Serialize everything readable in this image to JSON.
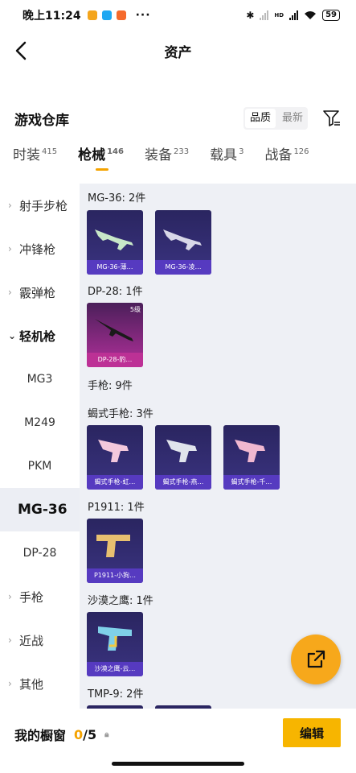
{
  "status_bar": {
    "time": "晚上11:24",
    "hd": "HD",
    "battery": "59",
    "more": "···"
  },
  "header": {
    "title": "资产"
  },
  "section": {
    "title": "游戏仓库",
    "sort_quality": "品质",
    "sort_latest": "最新"
  },
  "tabs": [
    {
      "label": "时装",
      "count": "415"
    },
    {
      "label": "枪械",
      "count": "146"
    },
    {
      "label": "装备",
      "count": "233"
    },
    {
      "label": "载具",
      "count": "3"
    },
    {
      "label": "战备",
      "count": "126"
    }
  ],
  "sidebar": {
    "categories": [
      {
        "label": "射手步枪"
      },
      {
        "label": "冲锋枪"
      },
      {
        "label": "霰弹枪"
      },
      {
        "label": "轻机枪"
      }
    ],
    "sub": [
      {
        "label": "MG3"
      },
      {
        "label": "M249"
      },
      {
        "label": "PKM"
      },
      {
        "label": "MG-36"
      },
      {
        "label": "DP-28"
      }
    ],
    "more": [
      {
        "label": "手枪"
      },
      {
        "label": "近战"
      },
      {
        "label": "其他"
      }
    ]
  },
  "groups": {
    "mg36": {
      "label": "MG-36: 2件",
      "items": [
        "MG-36-薄…",
        "MG-36-凌…"
      ]
    },
    "dp28": {
      "label": "DP-28: 1件",
      "items": [
        "DP-28-豹…"
      ],
      "level": "5级"
    },
    "pistol": {
      "label": "手枪: 9件"
    },
    "scorpion": {
      "label": "蝎式手枪: 3件",
      "items": [
        "蝎式手枪-虹…",
        "蝎式手枪-燕…",
        "蝎式手枪-千…"
      ]
    },
    "p1911": {
      "label": "P1911: 1件",
      "items": [
        "P1911-小狗…"
      ]
    },
    "deagle": {
      "label": "沙漠之鹰: 1件",
      "items": [
        "沙漠之鹰-云…"
      ]
    },
    "tmp9": {
      "label": "TMP-9: 2件"
    }
  },
  "footer": {
    "showcase": "我的橱窗",
    "current": "0",
    "total": "/5",
    "edit": "编辑"
  },
  "colors": {
    "accent": "#f5a300",
    "card_blue": "#3a3380",
    "card_pink": "#b1309a"
  }
}
